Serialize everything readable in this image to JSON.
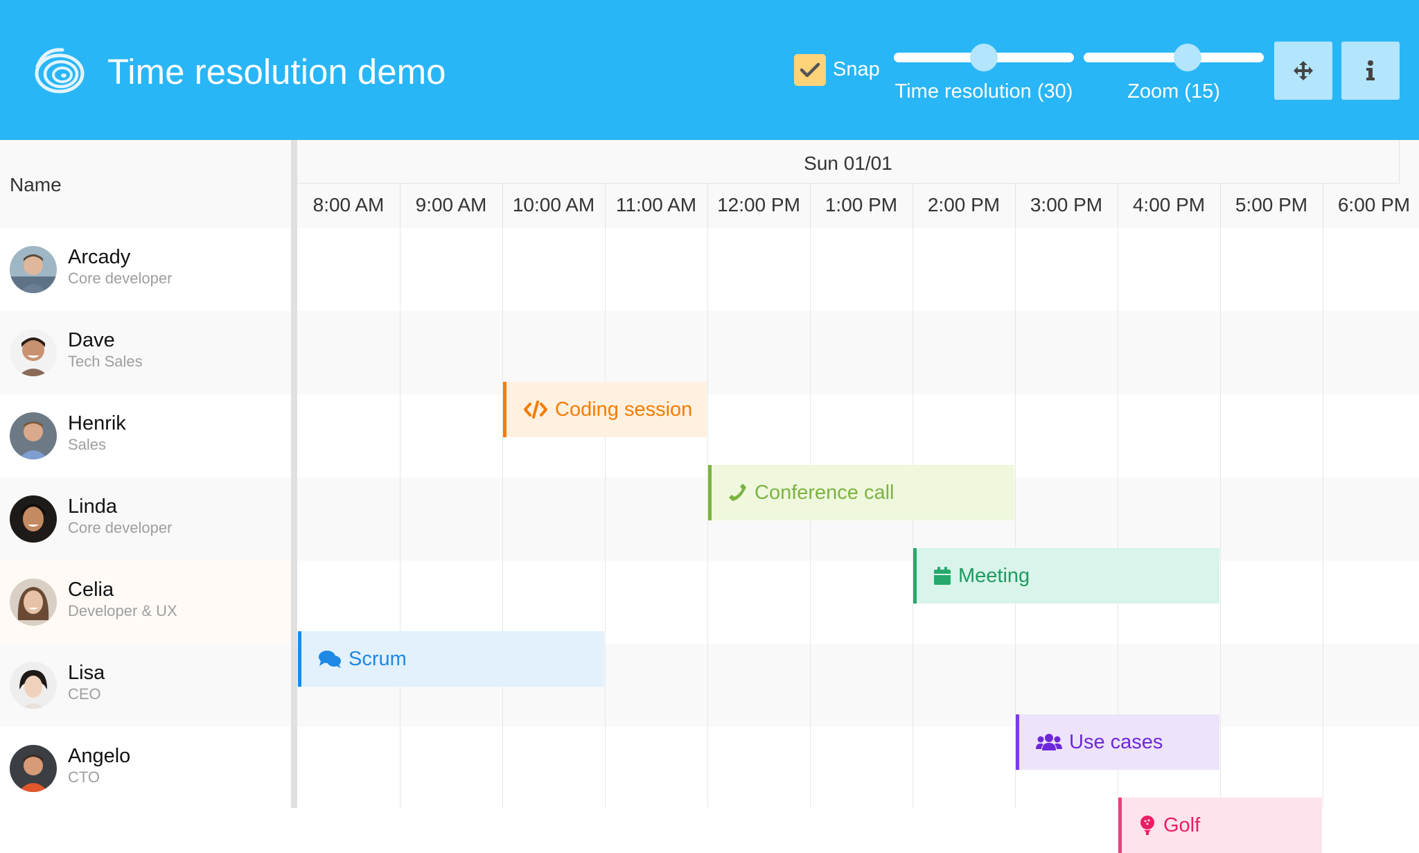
{
  "header": {
    "title": "Time resolution demo",
    "snap": {
      "label": "Snap",
      "checked": true
    },
    "time_resolution": {
      "label": "Time resolution (30)",
      "value": 30,
      "min": 0,
      "max": 60
    },
    "zoom": {
      "label": "Zoom (15)",
      "value": 15
    },
    "buttons": {
      "pan_icon": "move-arrows-icon",
      "info_icon": "info-icon"
    }
  },
  "grid": {
    "name_header": "Name",
    "date": "Sun 01/01",
    "hours": [
      "8:00 AM",
      "9:00 AM",
      "10:00 AM",
      "11:00 AM",
      "12:00 PM",
      "1:00 PM",
      "2:00 PM",
      "3:00 PM",
      "4:00 PM",
      "5:00 PM",
      "6:00 PM"
    ],
    "resources": [
      {
        "name": "Arcady",
        "role": "Core developer",
        "avatar": "avatar-arcady"
      },
      {
        "name": "Dave",
        "role": "Tech Sales",
        "avatar": "avatar-dave"
      },
      {
        "name": "Henrik",
        "role": "Sales",
        "avatar": "avatar-henrik"
      },
      {
        "name": "Linda",
        "role": "Core developer",
        "avatar": "avatar-linda"
      },
      {
        "name": "Celia",
        "role": "Developer & UX",
        "avatar": "avatar-celia"
      },
      {
        "name": "Lisa",
        "role": "CEO",
        "avatar": "avatar-lisa"
      },
      {
        "name": "Angelo",
        "role": "CTO",
        "avatar": "avatar-angelo"
      }
    ],
    "events": [
      {
        "name": "Coding session",
        "resource": "Arcady",
        "start": "10:00 AM",
        "end": "12:00 PM",
        "icon": "code-icon",
        "color": "#f57c00",
        "bg": "#fff0e0"
      },
      {
        "name": "Conference call",
        "resource": "Dave",
        "start": "12:00 PM",
        "end": "3:00 PM",
        "icon": "phone-icon",
        "color": "#7cb342",
        "bg": "#eff8dd"
      },
      {
        "name": "Meeting",
        "resource": "Henrik",
        "start": "2:00 PM",
        "end": "5:00 PM",
        "icon": "calendar-icon",
        "color": "#26a96c",
        "bg": "#d9f4ea"
      },
      {
        "name": "Scrum",
        "resource": "Linda",
        "start": "8:00 AM",
        "end": "11:00 AM",
        "icon": "comments-icon",
        "color": "#1e88e5",
        "bg": "#e2f1fc"
      },
      {
        "name": "Use cases",
        "resource": "Celia",
        "start": "3:00 PM",
        "end": "5:00 PM",
        "icon": "users-icon",
        "color": "#7c3aed",
        "bg": "#ede4fb"
      },
      {
        "name": "Golf",
        "resource": "Lisa",
        "start": "4:00 PM",
        "end": "6:00 PM",
        "icon": "golf-icon",
        "color": "#ec407a",
        "bg": "#fde3ec"
      }
    ]
  },
  "colors": {
    "header_bg": "#29b6f6",
    "button_bg": "#b3e5fc",
    "checkbox_bg": "#ffd37a"
  }
}
